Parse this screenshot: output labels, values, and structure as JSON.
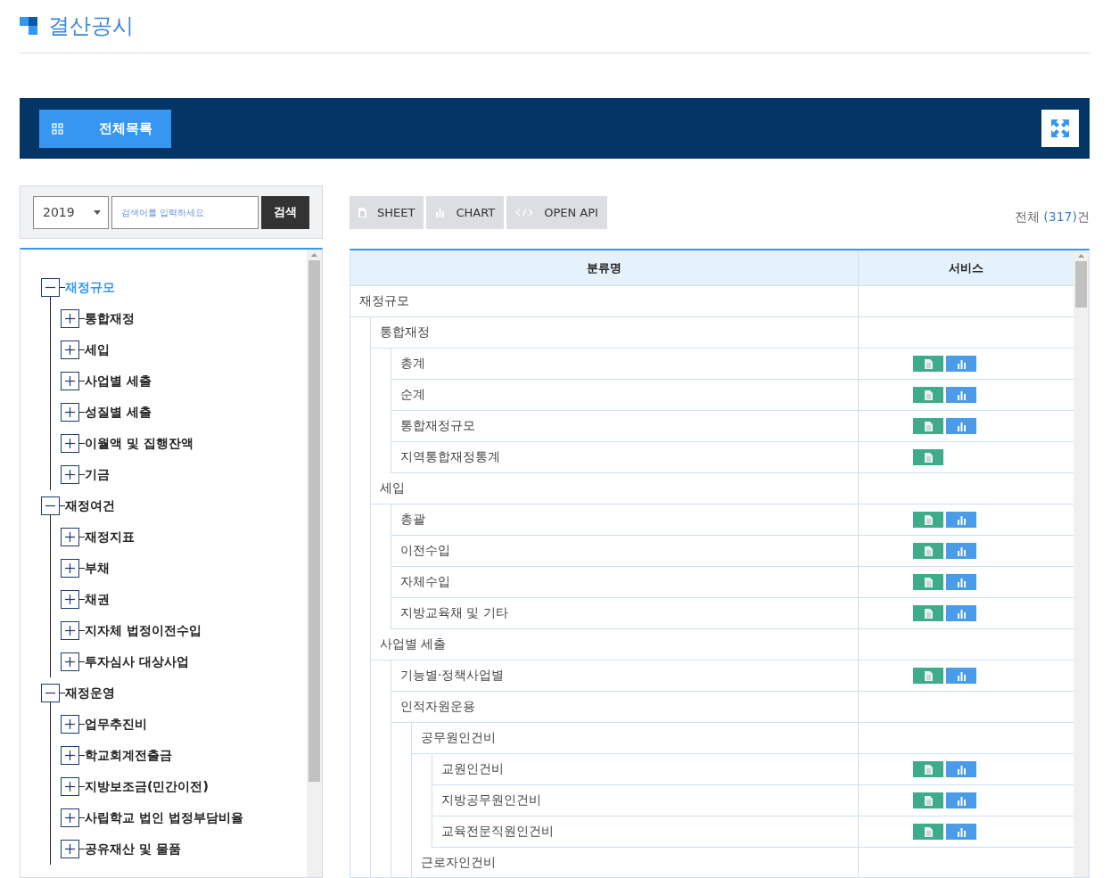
{
  "page_title": "결산공시",
  "banner": {
    "menu_button": "전체목록"
  },
  "search": {
    "year": "2019",
    "placeholder": "검색어를 입력하세요",
    "button": "검색"
  },
  "tree": [
    {
      "label": "재정규모",
      "expanded": true,
      "selected": true,
      "children": [
        {
          "label": "통합재정",
          "expanded": false,
          "selected": false
        },
        {
          "label": "세입",
          "expanded": false,
          "selected": false
        },
        {
          "label": "사업별 세출",
          "expanded": false,
          "selected": false
        },
        {
          "label": "성질별 세출",
          "expanded": false,
          "selected": false
        },
        {
          "label": "이월액 및 집행잔액",
          "expanded": false,
          "selected": false
        },
        {
          "label": "기금",
          "expanded": false,
          "selected": false
        }
      ]
    },
    {
      "label": "재정여건",
      "expanded": true,
      "selected": false,
      "children": [
        {
          "label": "재정지표",
          "expanded": false,
          "selected": false
        },
        {
          "label": "부채",
          "expanded": false,
          "selected": false
        },
        {
          "label": "채권",
          "expanded": false,
          "selected": false
        },
        {
          "label": "지자체 법정이전수입",
          "expanded": false,
          "selected": false
        },
        {
          "label": "투자심사 대상사업",
          "expanded": false,
          "selected": false
        }
      ]
    },
    {
      "label": "재정운영",
      "expanded": true,
      "selected": false,
      "children": [
        {
          "label": "업무추진비",
          "expanded": false,
          "selected": false
        },
        {
          "label": "학교회계전출금",
          "expanded": false,
          "selected": false
        },
        {
          "label": "지방보조금(민간이전)",
          "expanded": false,
          "selected": false
        },
        {
          "label": "사립학교 법인 법정부담비율",
          "expanded": false,
          "selected": false
        },
        {
          "label": "공유재산 및 물품",
          "expanded": false,
          "selected": false
        }
      ]
    }
  ],
  "view_tabs": [
    {
      "kind": "sheet",
      "label": "SHEET"
    },
    {
      "kind": "chart",
      "label": "CHART"
    },
    {
      "kind": "api",
      "label": "OPEN API"
    }
  ],
  "total": {
    "prefix": "전체",
    "count": "(317)",
    "suffix": "건"
  },
  "table": {
    "columns": [
      "분류명",
      "서비스"
    ],
    "rows": [
      {
        "name": "재정규모",
        "sheet": false,
        "chart": false,
        "children": [
          {
            "name": "통합재정",
            "sheet": false,
            "chart": false,
            "children": [
              {
                "name": "총계",
                "sheet": true,
                "chart": true
              },
              {
                "name": "순계",
                "sheet": true,
                "chart": true
              },
              {
                "name": "통합재정규모",
                "sheet": true,
                "chart": true
              },
              {
                "name": "지역통합재정통계",
                "sheet": true,
                "chart": false
              }
            ]
          },
          {
            "name": "세입",
            "sheet": false,
            "chart": false,
            "children": [
              {
                "name": "총괄",
                "sheet": true,
                "chart": true
              },
              {
                "name": "이전수입",
                "sheet": true,
                "chart": true
              },
              {
                "name": "자체수입",
                "sheet": true,
                "chart": true
              },
              {
                "name": "지방교육채 및 기타",
                "sheet": true,
                "chart": true
              }
            ]
          },
          {
            "name": "사업별 세출",
            "sheet": false,
            "chart": false,
            "children": [
              {
                "name": "기능별·정책사업별",
                "sheet": true,
                "chart": true
              },
              {
                "name": "인적자원운용",
                "sheet": false,
                "chart": false,
                "children": [
                  {
                    "name": "공무원인건비",
                    "sheet": false,
                    "chart": false,
                    "children": [
                      {
                        "name": "교원인건비",
                        "sheet": true,
                        "chart": true
                      },
                      {
                        "name": "지방공무원인건비",
                        "sheet": true,
                        "chart": true
                      },
                      {
                        "name": "교육전문직원인건비",
                        "sheet": true,
                        "chart": true
                      }
                    ]
                  },
                  {
                    "name": "근로자인건비",
                    "sheet": false,
                    "chart": false
                  }
                ]
              }
            ]
          }
        ]
      }
    ]
  }
}
